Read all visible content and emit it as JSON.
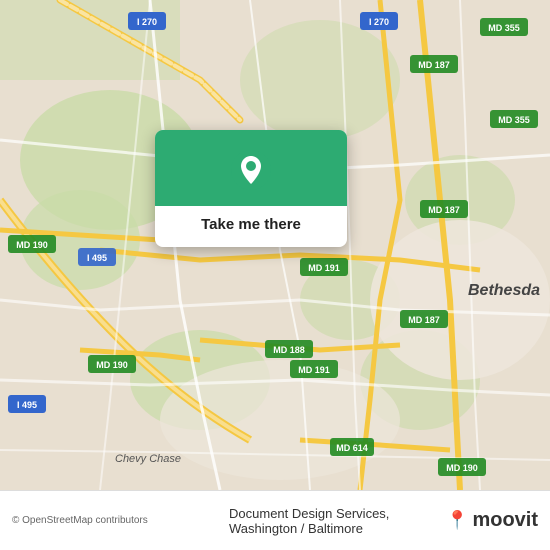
{
  "map": {
    "alt": "Street map of Washington DC / Baltimore area showing Bethesda",
    "copyright": "© OpenStreetMap contributors",
    "popup": {
      "button_label": "Take me there"
    },
    "bottom": {
      "business_name": "Document Design Services,",
      "location": "Washington / Baltimore",
      "brand": "moovit"
    }
  },
  "colors": {
    "green": "#2dab72",
    "road_yellow": "#f5d668",
    "road_white": "#ffffff",
    "road_orange": "#f0a830",
    "map_bg": "#e8e0d8",
    "map_green_area": "#c8dab5",
    "water": "#aad3df"
  },
  "road_labels": [
    "I 270",
    "MD 355",
    "MD 187",
    "MD 191",
    "I 495",
    "MD 190",
    "MD 188",
    "MD 614",
    "Bethesda"
  ],
  "icons": {
    "location_pin": "📍",
    "moovit_pin": "📍"
  }
}
